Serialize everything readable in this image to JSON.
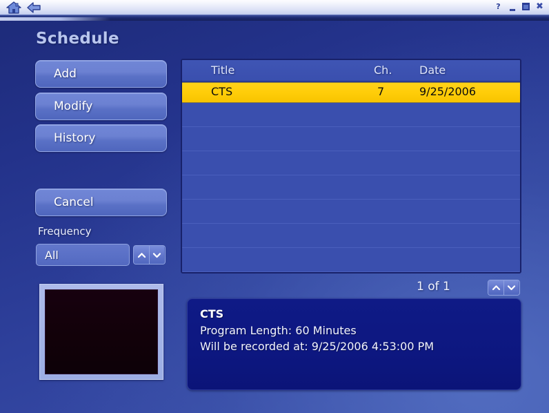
{
  "titlebar": {
    "home_icon": "home-icon",
    "back_icon": "back-arrow-icon",
    "help_label": "?",
    "minimize_label": "",
    "maximize_label": "",
    "close_label": "✖"
  },
  "page": {
    "title": "Schedule"
  },
  "sidebar": {
    "buttons": [
      {
        "label": "Add"
      },
      {
        "label": "Modify"
      },
      {
        "label": "History"
      }
    ],
    "cancel": {
      "label": "Cancel"
    },
    "frequency": {
      "label": "Frequency",
      "value": "All",
      "up_icon": "chevron-up-icon",
      "down_icon": "chevron-down-icon"
    },
    "preview": {
      "name": "video-preview"
    }
  },
  "table": {
    "columns": {
      "title": "Title",
      "channel": "Ch.",
      "date": "Date"
    },
    "rows": [
      {
        "title": "CTS",
        "channel": "7",
        "date": "9/25/2006",
        "selected": true
      },
      {
        "title": "",
        "channel": "",
        "date": "",
        "selected": false
      },
      {
        "title": "",
        "channel": "",
        "date": "",
        "selected": false
      },
      {
        "title": "",
        "channel": "",
        "date": "",
        "selected": false
      },
      {
        "title": "",
        "channel": "",
        "date": "",
        "selected": false
      },
      {
        "title": "",
        "channel": "",
        "date": "",
        "selected": false
      },
      {
        "title": "",
        "channel": "",
        "date": "",
        "selected": false
      },
      {
        "title": "",
        "channel": "",
        "date": "",
        "selected": false
      }
    ]
  },
  "pager": {
    "label": "1 of 1",
    "up_icon": "chevron-up-icon",
    "down_icon": "chevron-down-icon"
  },
  "details": {
    "title": "CTS",
    "line1": "Program Length: 60 Minutes",
    "line2": "Will be recorded at: 9/25/2006 4:53:00 PM"
  },
  "colors": {
    "accent_selected": "#ffcd09",
    "panel_bg": "#3a4fae",
    "details_bg": "#0d1780",
    "button_bg": "#6c81d2",
    "title_text": "#b9c6ee"
  }
}
